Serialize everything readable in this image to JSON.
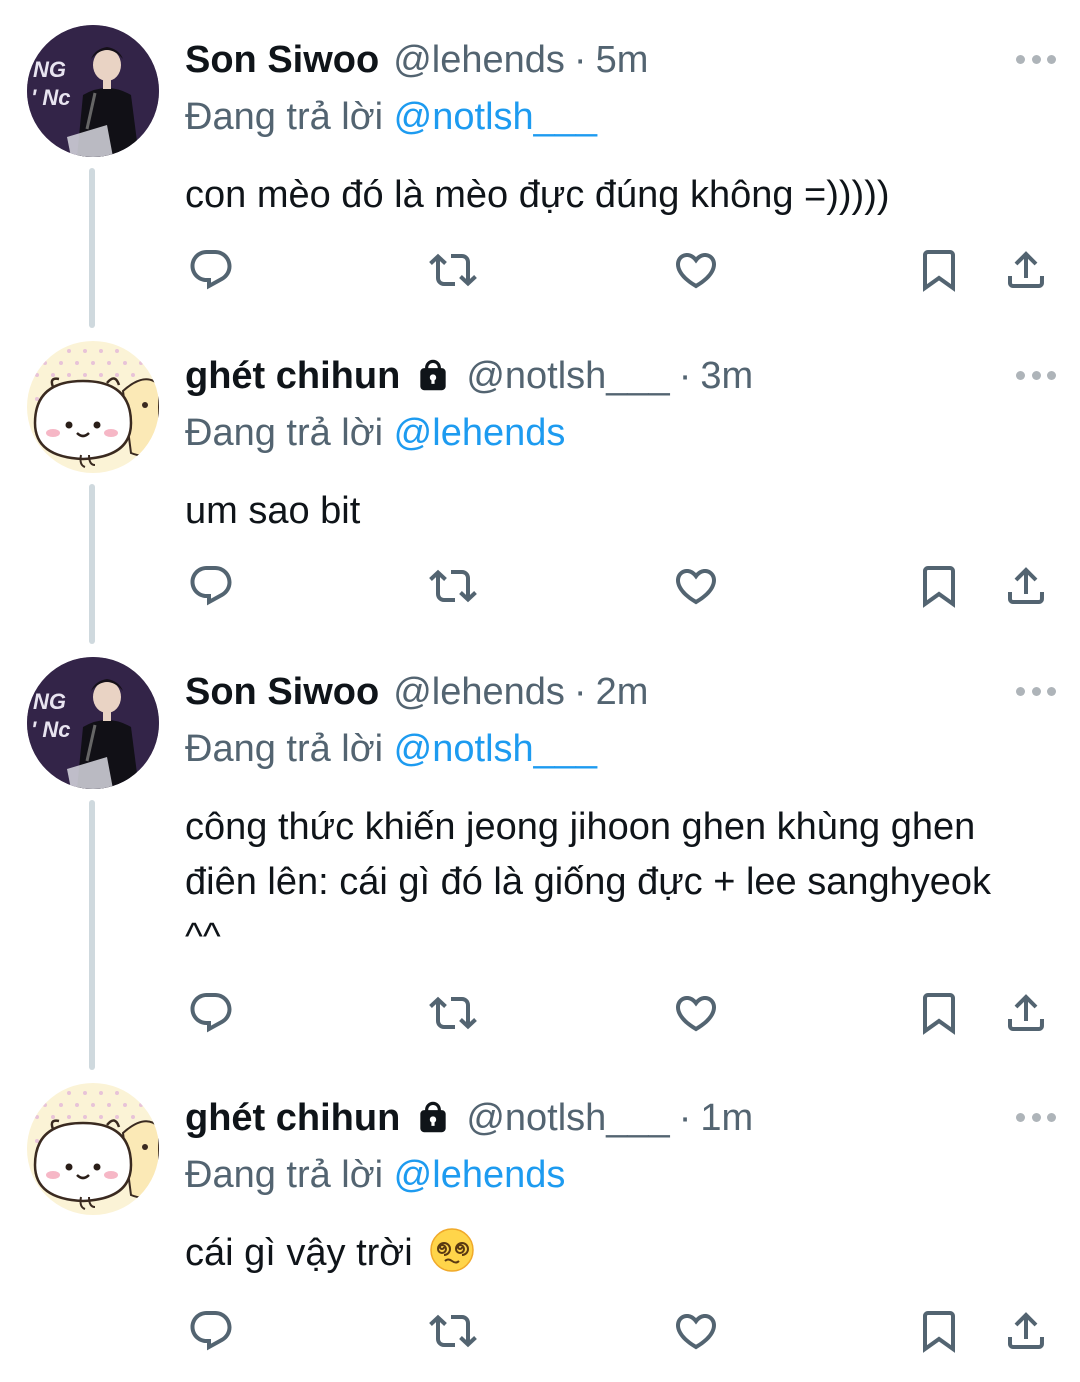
{
  "tweets": [
    {
      "name": "Son Siwoo",
      "handle": "@lehends",
      "time": "5m",
      "replying_prefix": "Đang trả lời",
      "replying_to": "@notlsh___",
      "text": "con mèo đó là mèo đực đúng không =)))))",
      "locked": false,
      "avatar": "photo-avatar"
    },
    {
      "name": "ghét chihun",
      "handle": "@notlsh___",
      "time": "3m",
      "replying_prefix": "Đang trả lời",
      "replying_to": "@lehends",
      "text": "um sao bit",
      "locked": true,
      "avatar": "cartoon-avatar"
    },
    {
      "name": "Son Siwoo",
      "handle": "@lehends",
      "time": "2m",
      "replying_prefix": "Đang trả lời",
      "replying_to": "@notlsh___",
      "text": "công thức khiến jeong jihoon ghen khùng ghen điên lên: cái gì đó là giống đực + lee sanghyeok ^^",
      "locked": false,
      "avatar": "photo-avatar"
    },
    {
      "name": "ghét chihun",
      "handle": "@notlsh___",
      "time": "1m",
      "replying_prefix": "Đang trả lời",
      "replying_to": "@lehends",
      "text": "cái gì vậy trời",
      "emoji": "dizzy-face-emoji",
      "locked": true,
      "avatar": "cartoon-avatar"
    }
  ],
  "separator": "·",
  "actions": [
    "reply-icon",
    "retweet-icon",
    "like-icon",
    "bookmark-icon",
    "share-icon"
  ],
  "colors": {
    "text": "#0f1419",
    "secondary": "#536471",
    "mention": "#1d9bf0",
    "icon": "#536471",
    "thread_line": "#cfd9de"
  }
}
